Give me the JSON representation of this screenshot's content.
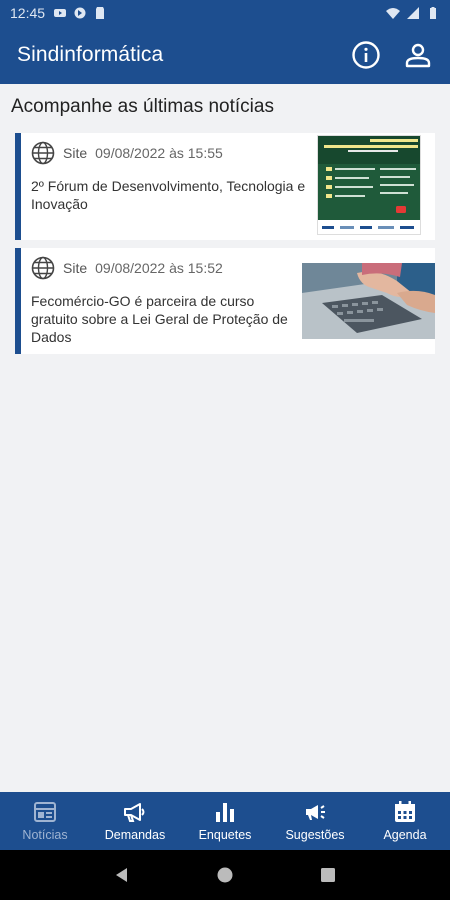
{
  "status_bar": {
    "time": "12:45",
    "left_icons": [
      "youtube-icon",
      "location-icon",
      "sd-card-icon"
    ],
    "right_icons": [
      "wifi-icon",
      "signal-icon",
      "battery-icon"
    ]
  },
  "app_bar": {
    "title": "Sindinformática",
    "actions": [
      "info-icon",
      "account-icon"
    ]
  },
  "section_title": "Acompanhe as últimas notícias",
  "news": [
    {
      "source": "Site",
      "date": "09/08/2022 às 15:55",
      "title": "2º Fórum de Desenvolvimento, Tecnologia e Inovação",
      "icon": "globe-icon"
    },
    {
      "source": "Site",
      "date": "09/08/2022 às 15:52",
      "title": "Fecomércio-GO é parceira de curso gratuito sobre a Lei Geral de Proteção de Dados",
      "icon": "globe-icon"
    }
  ],
  "bottom_nav": {
    "items": [
      {
        "label": "Notícias",
        "icon": "newspaper-icon",
        "active": true
      },
      {
        "label": "Demandas",
        "icon": "megaphone-icon",
        "active": false
      },
      {
        "label": "Enquetes",
        "icon": "bar-chart-icon",
        "active": false
      },
      {
        "label": "Sugestões",
        "icon": "campaign-icon",
        "active": false
      },
      {
        "label": "Agenda",
        "icon": "calendar-icon",
        "active": false
      }
    ]
  },
  "colors": {
    "primary": "#1d4e8f",
    "background": "#f1f2f4",
    "active_nav": "#9fb4d2"
  }
}
